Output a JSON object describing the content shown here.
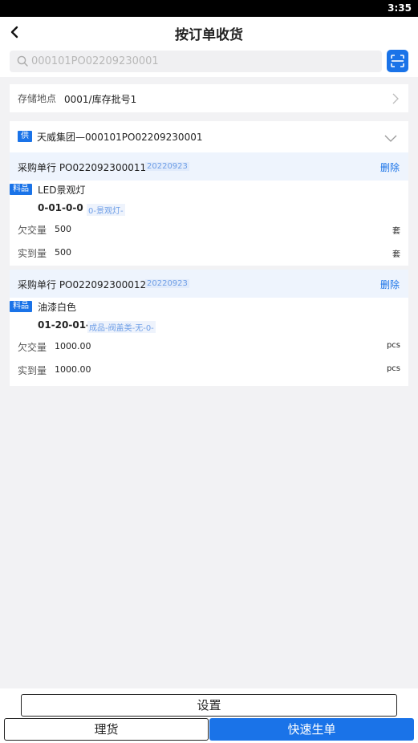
{
  "status_bar": {
    "time": "3:35"
  },
  "header": {
    "title": "按订单收货"
  },
  "search": {
    "placeholder": "000101PO02209230001"
  },
  "location": {
    "label": "存储地点",
    "value": "0001/库存批号1"
  },
  "order": {
    "supplier_tag": "供",
    "supplier_name": "天威集团—000101PO02209230001",
    "lines": [
      {
        "line_label": "采购单行 PO0220923000111",
        "date": "20220923",
        "delete_label": "删除",
        "item_tag": "料品",
        "item_name": "LED景观灯",
        "item_code": "0-01-0-0",
        "item_spec": "0-景观灯-",
        "owed_label": "欠交量",
        "owed_value": "500",
        "owed_unit": "套",
        "received_label": "实到量",
        "received_value": "500",
        "received_unit": "套"
      },
      {
        "line_label": "采购单行 PO0220923000121",
        "date": "20220923",
        "delete_label": "删除",
        "item_tag": "料品",
        "item_name": "油漆白色",
        "item_code": "01-20-01-0",
        "item_spec": "成品-阀盖类-无-0-",
        "owed_label": "欠交量",
        "owed_value": "1000.00",
        "owed_unit": "pcs",
        "received_label": "实到量",
        "received_value": "1000.00",
        "received_unit": "pcs"
      }
    ]
  },
  "footer": {
    "settings_label": "设置",
    "arrange_label": "理货",
    "quick_create_label": "快速生单"
  },
  "colors": {
    "accent": "#1a73e8",
    "line_header_bg": "#eef4fd",
    "page_bg": "#f2f2f4"
  }
}
